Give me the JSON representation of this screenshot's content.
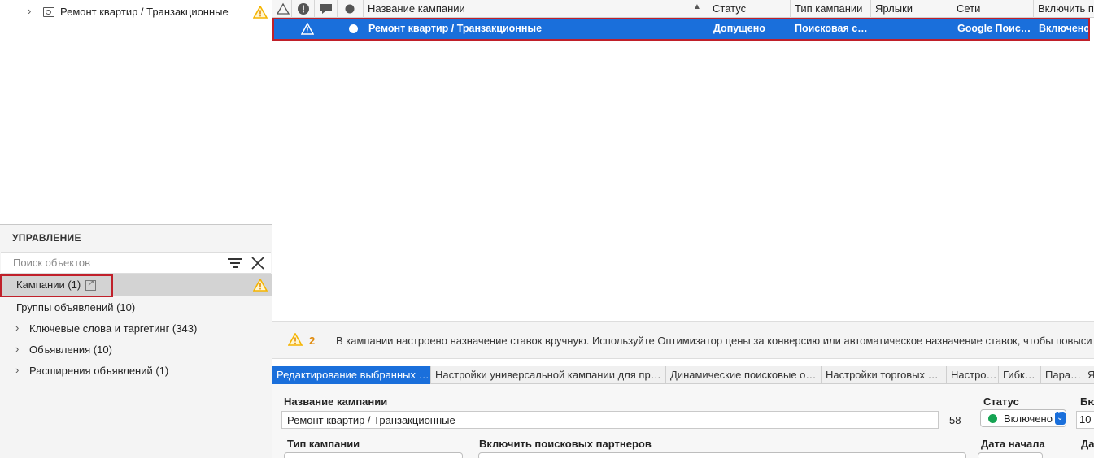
{
  "tree": {
    "item_label": "Ремонт квартир / Транзакционные"
  },
  "management": {
    "title": "УПРАВЛЕНИЕ",
    "search_placeholder": "Поиск объектов",
    "items": [
      {
        "label": "Кампании (1)"
      },
      {
        "label": "Группы объявлений (10)"
      },
      {
        "label": "Ключевые слова и таргетинг (343)"
      },
      {
        "label": "Объявления (10)"
      },
      {
        "label": "Расширения объявлений (1)"
      }
    ]
  },
  "grid": {
    "columns": [
      "Название кампании",
      "Статус",
      "Тип кампании",
      "Ярлыки",
      "Сети",
      "Включить по"
    ],
    "row": {
      "name": "Ремонт квартир / Транзакционные",
      "status": "Допущено",
      "type": "Поисковая с…",
      "labels": "",
      "networks": "Google Поис…",
      "enabled": "Включено"
    }
  },
  "notice": {
    "count": "2",
    "text": "В кампании настроено назначение ставок вручную. Используйте Оптимизатор цены за конверсию или автоматическое назначение ставок, чтобы повыси…"
  },
  "tabs": [
    "Редактирование выбранных …",
    "Настройки универсальной кампании для пр…",
    "Динамические поисковые о…",
    "Настройки торговых …",
    "Настро…",
    "Гибк…",
    "Пара…",
    "Я"
  ],
  "editor": {
    "name_label": "Название кампании",
    "name_value": "Ремонт квартир / Транзакционные",
    "name_count": "58",
    "status_label": "Статус",
    "status_value": "Включено",
    "budget_label": "Бю",
    "budget_value": "10",
    "type_label": "Тип кампании",
    "partners_label": "Включить поисковых партнеров",
    "start_label": "Дата начала",
    "end_label": "Да"
  },
  "colors": {
    "selection_blue": "#1a6fdb",
    "highlight_red": "#c0202a",
    "warning_yellow": "#f5b400",
    "status_green": "#15a352"
  }
}
